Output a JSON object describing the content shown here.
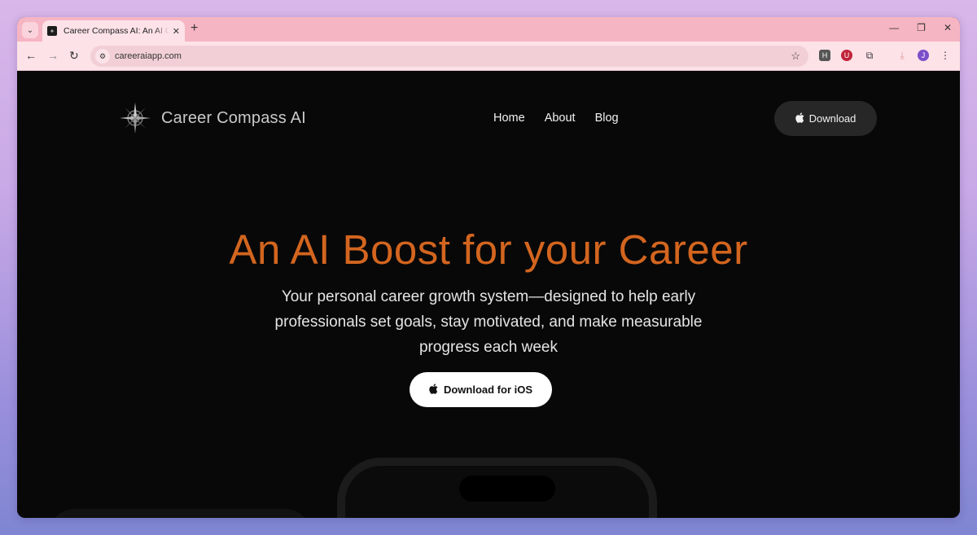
{
  "browser": {
    "tab": {
      "title": "Career Compass AI: An AI Career"
    },
    "new_tab_label": "+",
    "url": "careeraiapp.com",
    "extensions": [
      "H",
      "U",
      "J"
    ]
  },
  "site": {
    "brand": "Career Compass AI",
    "nav": {
      "home": "Home",
      "about": "About",
      "blog": "Blog"
    },
    "header_button": "Download",
    "hero_title": "An AI Boost for your Career",
    "hero_subtitle": "Your personal career growth system—designed to help early professionals set goals, stay motivated, and make measurable progress each week",
    "cta_button": "Download for iOS"
  },
  "colors": {
    "accent": "#d3651f",
    "page_bg": "#080808",
    "tab_strip": "#f6b5c3"
  }
}
